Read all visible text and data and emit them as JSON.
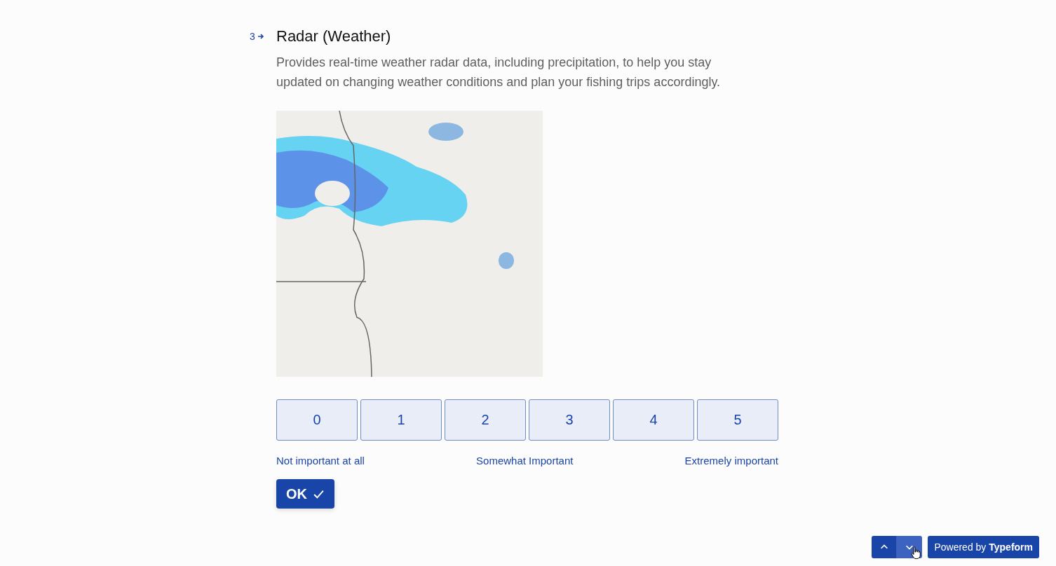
{
  "question": {
    "number": "3",
    "title": "Radar (Weather)",
    "description": "Provides real-time weather radar data, including precipitation, to help you stay updated on changing weather conditions and plan your fishing trips accordingly."
  },
  "scale": {
    "options": [
      {
        "label": "0",
        "selected": false
      },
      {
        "label": "1",
        "selected": false
      },
      {
        "label": "2",
        "selected": false
      },
      {
        "label": "3",
        "selected": false
      },
      {
        "label": "4",
        "selected": false
      },
      {
        "label": "5",
        "selected": false
      }
    ],
    "labels": [
      "Not important at all",
      "Somewhat Important",
      "Extremely important"
    ]
  },
  "ok_button": "OK",
  "nav": [
    {
      "kind": "up",
      "hovered": false
    },
    {
      "kind": "down",
      "hovered": true
    }
  ],
  "branding": "Powered by **Typeform**"
}
